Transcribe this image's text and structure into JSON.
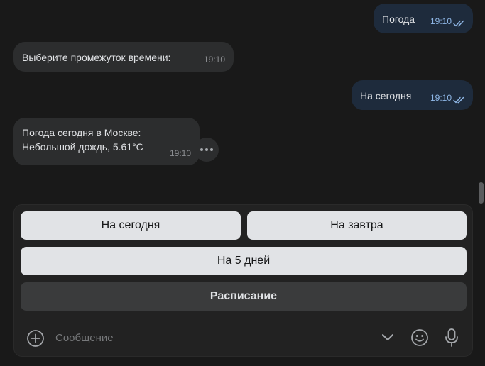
{
  "messages": [
    {
      "direction": "out",
      "text": "Погода",
      "time": "19:10",
      "read": true
    },
    {
      "direction": "in",
      "text": "Выберите промежуток времени:",
      "time": "19:10"
    },
    {
      "direction": "out",
      "text": "На сегодня",
      "time": "19:10",
      "read": true
    },
    {
      "direction": "in",
      "lines": [
        "Погода сегодня в Москве:",
        "Небольшой дождь, 5.61°C"
      ],
      "time": "19:10"
    }
  ],
  "keyboard": {
    "buttons": [
      {
        "label": "На сегодня",
        "style": "light"
      },
      {
        "label": "На завтра",
        "style": "light"
      },
      {
        "label": "На 5 дней",
        "style": "light"
      },
      {
        "label": "Расписание",
        "style": "dark"
      }
    ]
  },
  "composer": {
    "placeholder": "Сообщение",
    "value": ""
  },
  "icons": {
    "attach": "plus-circle-icon",
    "collapse_keyboard": "chevron-down-icon",
    "emoji": "smile-icon",
    "voice": "microphone-icon",
    "more": "more-dots-icon",
    "read_status": "double-check-icon"
  },
  "colors": {
    "background": "#191919",
    "incoming_bubble": "#2c2d2e",
    "outgoing_bubble": "#1e2b3c",
    "outgoing_time": "#8fb7e6",
    "keyboard_light": "#e1e3e6",
    "keyboard_dark": "#3a3b3c"
  }
}
